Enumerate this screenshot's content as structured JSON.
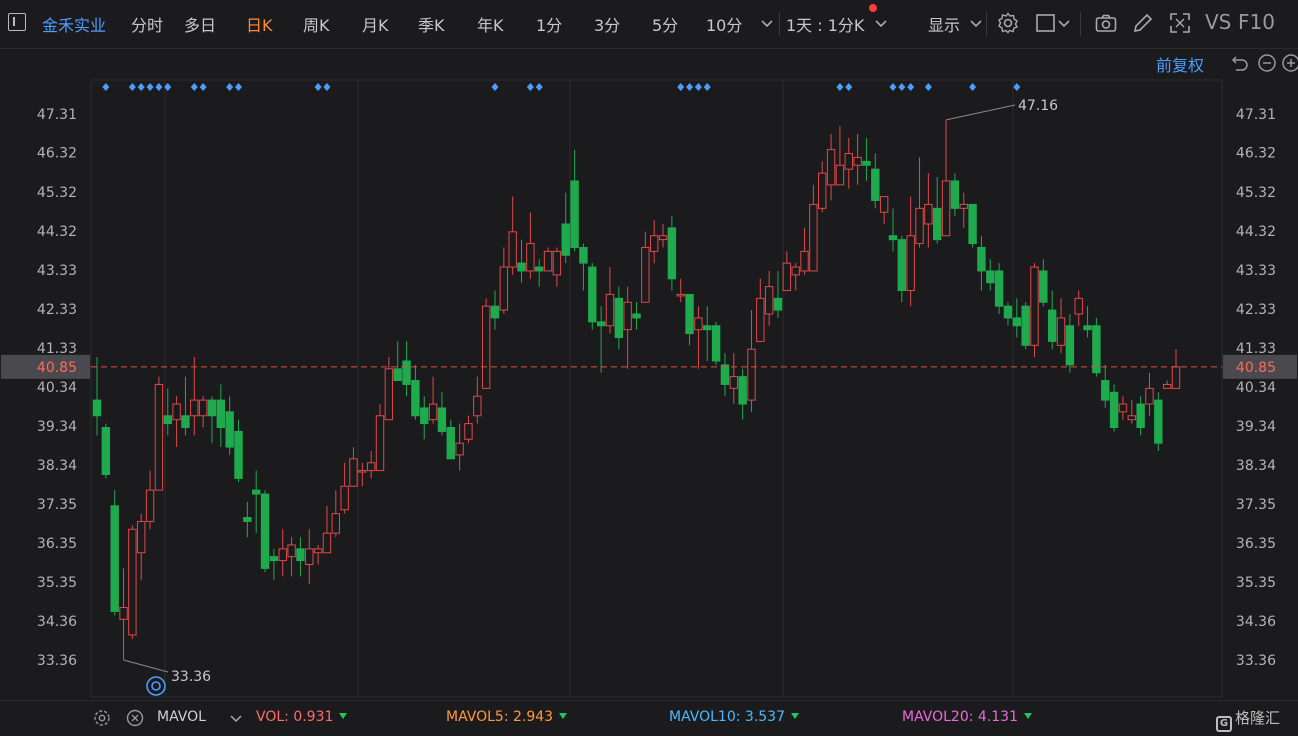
{
  "toolbar": {
    "stock_name": "金禾实业",
    "periods": [
      {
        "label": "分时",
        "active": false
      },
      {
        "label": "多日",
        "active": false
      },
      {
        "label": "日K",
        "active": true
      },
      {
        "label": "周K",
        "active": false
      },
      {
        "label": "月K",
        "active": false
      },
      {
        "label": "季K",
        "active": false
      },
      {
        "label": "年K",
        "active": false
      },
      {
        "label": "1分",
        "active": false
      },
      {
        "label": "3分",
        "active": false
      },
      {
        "label": "5分",
        "active": false
      },
      {
        "label": "10分",
        "active": false
      }
    ],
    "interval_selector": "1天 : 1分K",
    "display_label": "显示",
    "vs_label": "VS",
    "f10_label": "F10"
  },
  "chart_header": {
    "adjust_label": "前复权"
  },
  "price_axis": {
    "ticks": [
      "47.31",
      "46.32",
      "45.32",
      "44.32",
      "43.33",
      "42.33",
      "41.33",
      "40.34",
      "39.34",
      "38.34",
      "37.35",
      "36.35",
      "35.35",
      "34.36",
      "33.36"
    ],
    "current": "40.85"
  },
  "annotations": {
    "high_label": "47.16",
    "low_label": "33.36"
  },
  "colors": {
    "up": "#e04848",
    "down": "#1faa4e",
    "accent": "#4c9dff",
    "active_tab": "#ff8c3a",
    "current_line": "#e0533a"
  },
  "indicator_bar": {
    "name": "MAVOL",
    "items": [
      {
        "label": "VOL:",
        "value": "0.931",
        "color": "#ff6b6b"
      },
      {
        "label": "MAVOL5:",
        "value": "2.943",
        "color": "#ff9a3c"
      },
      {
        "label": "MAVOL10:",
        "value": "3.537",
        "color": "#4db8ff"
      },
      {
        "label": "MAVOL20:",
        "value": "4.131",
        "color": "#e86bd8"
      }
    ],
    "brand": "格隆汇"
  },
  "chart_data": {
    "type": "candlestick",
    "ylim": [
      32.9,
      48.2
    ],
    "candles": [
      [
        40.0,
        39.6,
        41.1,
        39.1
      ],
      [
        39.3,
        38.1,
        39.4,
        38.0
      ],
      [
        37.3,
        34.6,
        37.7,
        34.5
      ],
      [
        34.4,
        34.7,
        35.7,
        33.36
      ],
      [
        34.0,
        36.7,
        36.8,
        33.9
      ],
      [
        36.1,
        36.9,
        37.1,
        35.4
      ],
      [
        36.9,
        37.7,
        38.2,
        36.7
      ],
      [
        37.7,
        40.4,
        40.6,
        37.7
      ],
      [
        39.6,
        39.4,
        40.3,
        39.1
      ],
      [
        39.5,
        39.9,
        40.1,
        38.8
      ],
      [
        39.6,
        39.3,
        40.6,
        39.1
      ],
      [
        39.6,
        40.0,
        41.1,
        39.1
      ],
      [
        39.6,
        40.0,
        40.1,
        39.3
      ],
      [
        40.0,
        39.6,
        40.1,
        38.9
      ],
      [
        40.0,
        39.3,
        40.4,
        38.8
      ],
      [
        39.7,
        38.8,
        40.1,
        38.6
      ],
      [
        39.2,
        38.0,
        39.5,
        37.9
      ],
      [
        37.0,
        36.9,
        37.4,
        36.5
      ],
      [
        37.7,
        37.6,
        38.2,
        36.6
      ],
      [
        37.6,
        35.7,
        37.7,
        35.6
      ],
      [
        36.0,
        35.9,
        36.2,
        35.4
      ],
      [
        35.9,
        36.2,
        36.7,
        35.5
      ],
      [
        36.0,
        36.3,
        36.5,
        35.5
      ],
      [
        36.2,
        35.9,
        36.5,
        35.5
      ],
      [
        35.8,
        36.2,
        36.7,
        35.3
      ],
      [
        36.1,
        36.2,
        36.3,
        35.8
      ],
      [
        36.1,
        36.6,
        37.3,
        36.1
      ],
      [
        36.6,
        37.1,
        37.7,
        36.5
      ],
      [
        37.2,
        37.8,
        38.4,
        37.1
      ],
      [
        37.8,
        38.5,
        38.8,
        37.8
      ],
      [
        38.2,
        38.2,
        38.4,
        37.8
      ],
      [
        38.2,
        38.4,
        38.7,
        38.0
      ],
      [
        38.2,
        39.6,
        39.9,
        38.2
      ],
      [
        39.5,
        40.8,
        41.1,
        39.5
      ],
      [
        40.8,
        40.5,
        41.5,
        40.5
      ],
      [
        41.0,
        40.4,
        41.5,
        40.1
      ],
      [
        40.5,
        39.6,
        40.9,
        39.5
      ],
      [
        39.8,
        39.4,
        40.1,
        39.0
      ],
      [
        39.5,
        39.9,
        40.6,
        39.4
      ],
      [
        39.8,
        39.2,
        40.2,
        39.1
      ],
      [
        39.3,
        38.5,
        39.5,
        38.5
      ],
      [
        38.6,
        38.9,
        39.4,
        38.2
      ],
      [
        39.0,
        39.4,
        39.6,
        38.9
      ],
      [
        39.6,
        40.1,
        40.6,
        39.4
      ],
      [
        40.3,
        42.4,
        42.6,
        40.3
      ],
      [
        42.4,
        42.1,
        42.8,
        41.8
      ],
      [
        42.3,
        43.4,
        43.9,
        42.2
      ],
      [
        43.4,
        44.3,
        45.2,
        43.2
      ],
      [
        43.5,
        43.3,
        44.1,
        43.0
      ],
      [
        43.3,
        44.0,
        44.8,
        43.1
      ],
      [
        43.4,
        43.3,
        43.6,
        42.9
      ],
      [
        43.3,
        43.8,
        43.9,
        43.3
      ],
      [
        43.2,
        43.8,
        43.9,
        42.9
      ],
      [
        44.5,
        43.7,
        45.3,
        43.5
      ],
      [
        45.6,
        43.9,
        46.4,
        43.8
      ],
      [
        43.9,
        43.5,
        44.0,
        42.8
      ],
      [
        43.4,
        42.0,
        43.5,
        41.8
      ],
      [
        42.0,
        41.9,
        42.4,
        40.7
      ],
      [
        41.9,
        42.7,
        43.4,
        41.7
      ],
      [
        42.6,
        41.6,
        42.9,
        41.3
      ],
      [
        41.8,
        42.5,
        42.9,
        40.8
      ],
      [
        42.2,
        42.1,
        42.5,
        41.8
      ],
      [
        42.5,
        43.9,
        44.3,
        42.5
      ],
      [
        43.8,
        44.2,
        44.6,
        43.5
      ],
      [
        44.1,
        44.2,
        44.5,
        43.9
      ],
      [
        44.4,
        43.1,
        44.7,
        42.8
      ],
      [
        42.7,
        42.7,
        43.1,
        42.5
      ],
      [
        42.7,
        41.7,
        42.7,
        41.4
      ],
      [
        41.8,
        42.1,
        42.4,
        40.8
      ],
      [
        41.9,
        41.8,
        42.4,
        41.0
      ],
      [
        41.9,
        41.0,
        42.0,
        40.9
      ],
      [
        40.9,
        40.4,
        41.2,
        40.1
      ],
      [
        40.3,
        40.6,
        41.2,
        39.9
      ],
      [
        40.6,
        39.9,
        40.8,
        39.5
      ],
      [
        40.0,
        41.3,
        42.3,
        39.7
      ],
      [
        41.5,
        42.6,
        43.1,
        41.5
      ],
      [
        42.2,
        42.9,
        43.3,
        41.9
      ],
      [
        42.6,
        42.3,
        43.3,
        42.1
      ],
      [
        42.8,
        43.5,
        43.8,
        42.8
      ],
      [
        43.2,
        43.4,
        43.5,
        42.8
      ],
      [
        43.3,
        43.8,
        44.4,
        43.2
      ],
      [
        43.3,
        45.0,
        45.5,
        43.3
      ],
      [
        44.9,
        45.8,
        46.1,
        44.8
      ],
      [
        45.5,
        46.4,
        46.8,
        45.1
      ],
      [
        45.5,
        46.0,
        47.0,
        45.5
      ],
      [
        45.9,
        46.3,
        46.7,
        45.4
      ],
      [
        46.0,
        46.2,
        46.8,
        45.5
      ],
      [
        46.1,
        46.0,
        46.7,
        45.6
      ],
      [
        45.9,
        45.1,
        46.3,
        44.9
      ],
      [
        44.8,
        45.2,
        45.2,
        44.5
      ],
      [
        44.2,
        44.1,
        44.9,
        43.8
      ],
      [
        44.1,
        42.8,
        44.2,
        42.5
      ],
      [
        42.8,
        44.2,
        45.2,
        42.4
      ],
      [
        44.0,
        44.9,
        46.2,
        43.9
      ],
      [
        44.5,
        45.0,
        45.8,
        43.9
      ],
      [
        44.9,
        44.1,
        45.7,
        44.0
      ],
      [
        44.2,
        45.6,
        47.16,
        44.2
      ],
      [
        45.6,
        44.9,
        45.8,
        44.7
      ],
      [
        44.9,
        45.0,
        45.3,
        44.4
      ],
      [
        45.0,
        44.0,
        45.0,
        43.9
      ],
      [
        43.9,
        43.3,
        44.2,
        42.8
      ],
      [
        43.3,
        43.0,
        43.6,
        42.8
      ],
      [
        43.3,
        42.4,
        43.5,
        42.2
      ],
      [
        42.4,
        42.1,
        42.5,
        41.9
      ],
      [
        42.1,
        41.9,
        42.6,
        41.6
      ],
      [
        42.4,
        41.4,
        42.5,
        41.3
      ],
      [
        41.4,
        43.4,
        43.5,
        41.1
      ],
      [
        43.3,
        42.5,
        43.6,
        42.4
      ],
      [
        42.3,
        41.5,
        42.8,
        41.3
      ],
      [
        41.4,
        42.1,
        42.6,
        41.2
      ],
      [
        41.9,
        40.9,
        42.2,
        40.7
      ],
      [
        42.2,
        42.6,
        42.8,
        41.9
      ],
      [
        41.9,
        41.8,
        42.4,
        41.6
      ],
      [
        41.9,
        40.7,
        42.1,
        40.6
      ],
      [
        40.5,
        40.0,
        40.9,
        39.8
      ],
      [
        40.2,
        39.3,
        40.4,
        39.2
      ],
      [
        39.7,
        39.9,
        40.1,
        39.5
      ],
      [
        39.5,
        39.6,
        40.0,
        39.4
      ],
      [
        39.9,
        39.3,
        40.1,
        39.1
      ],
      [
        39.9,
        40.3,
        40.7,
        39.6
      ],
      [
        40.0,
        38.9,
        40.2,
        38.7
      ],
      [
        40.3,
        40.4,
        40.5,
        40.3
      ],
      [
        40.3,
        40.85,
        41.3,
        40.3
      ]
    ],
    "marker_indices": [
      1,
      4,
      5,
      6,
      7,
      8,
      11,
      12,
      15,
      16,
      25,
      26,
      45,
      49,
      50,
      66,
      67,
      68,
      69,
      84,
      85,
      90,
      91,
      92,
      94,
      99,
      104
    ]
  }
}
